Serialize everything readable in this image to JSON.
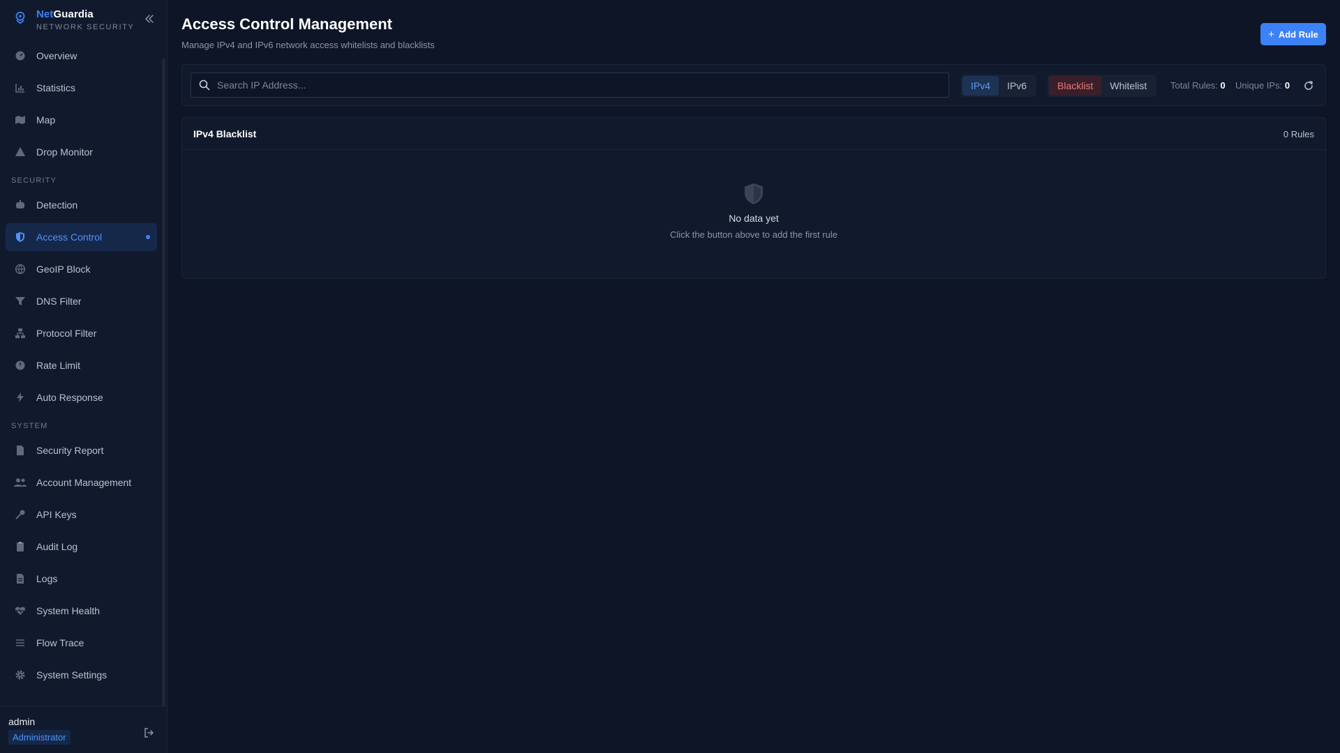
{
  "brand": {
    "name_accent": "Net",
    "name_rest": "Guardia",
    "tagline": "NETWORK SECURITY"
  },
  "sidebar": {
    "main_items": [
      {
        "label": "Overview",
        "icon": "dashboard-icon"
      },
      {
        "label": "Statistics",
        "icon": "bar-chart-icon"
      },
      {
        "label": "Map",
        "icon": "map-icon"
      },
      {
        "label": "Drop Monitor",
        "icon": "warning-icon"
      }
    ],
    "security_label": "SECURITY",
    "security_items": [
      {
        "label": "Detection",
        "icon": "robot-icon"
      },
      {
        "label": "Access Control",
        "icon": "shield-icon",
        "active": true
      },
      {
        "label": "GeoIP Block",
        "icon": "globe-icon"
      },
      {
        "label": "DNS Filter",
        "icon": "filter-icon"
      },
      {
        "label": "Protocol Filter",
        "icon": "network-icon"
      },
      {
        "label": "Rate Limit",
        "icon": "gauge-icon"
      },
      {
        "label": "Auto Response",
        "icon": "bolt-icon"
      }
    ],
    "system_label": "SYSTEM",
    "system_items": [
      {
        "label": "Security Report",
        "icon": "document-icon"
      },
      {
        "label": "Account Management",
        "icon": "users-icon"
      },
      {
        "label": "API Keys",
        "icon": "key-icon"
      },
      {
        "label": "Audit Log",
        "icon": "clipboard-icon"
      },
      {
        "label": "Logs",
        "icon": "file-icon"
      },
      {
        "label": "System Health",
        "icon": "heartbeat-icon"
      },
      {
        "label": "Flow Trace",
        "icon": "list-icon"
      },
      {
        "label": "System Settings",
        "icon": "gear-icon"
      }
    ]
  },
  "user": {
    "name": "admin",
    "role": "Administrator"
  },
  "header": {
    "title": "Access Control Management",
    "subtitle": "Manage IPv4 and IPv6 network access whitelists and blacklists",
    "add_rule_label": "Add Rule"
  },
  "toolbar": {
    "search_placeholder": "Search IP Address...",
    "ip_versions": [
      "IPv4",
      "IPv6"
    ],
    "selected_ip_version": "IPv4",
    "list_types": [
      "Blacklist",
      "Whitelist"
    ],
    "selected_list_type": "Blacklist",
    "total_rules_label": "Total Rules:",
    "total_rules_value": "0",
    "unique_ips_label": "Unique IPs:",
    "unique_ips_value": "0"
  },
  "panel": {
    "title": "IPv4 Blacklist",
    "count": "0 Rules",
    "empty_title": "No data yet",
    "empty_hint": "Click the button above to add the first rule"
  },
  "colors": {
    "accent": "#3b82f6",
    "background": "#0d1526",
    "sidebar": "#111a2c",
    "blacklist": "#e77a7a"
  }
}
